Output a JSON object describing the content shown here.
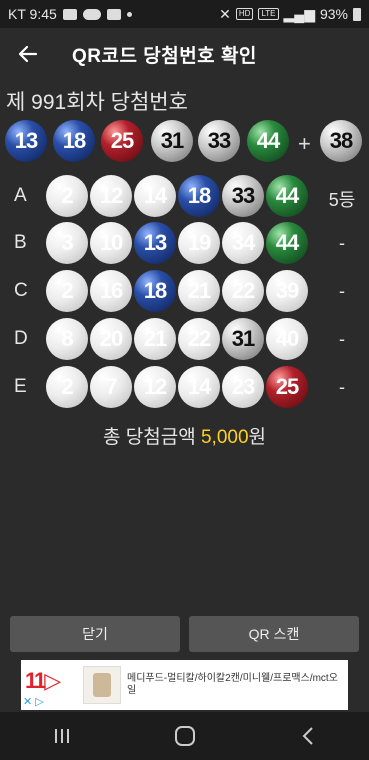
{
  "status_bar": {
    "time": "KT 9:45",
    "battery": "93%",
    "network": "LTE"
  },
  "app_bar": {
    "title": "QR코드 당첨번호 확인"
  },
  "winning": {
    "title": "제 991회차 당첨번호",
    "numbers": [
      {
        "value": "13",
        "color": "blue"
      },
      {
        "value": "18",
        "color": "blue"
      },
      {
        "value": "25",
        "color": "red"
      },
      {
        "value": "31",
        "color": "gray"
      },
      {
        "value": "33",
        "color": "gray"
      },
      {
        "value": "44",
        "color": "green"
      }
    ],
    "plus": "+",
    "bonus": {
      "value": "38",
      "color": "gray"
    }
  },
  "games": [
    {
      "label": "A",
      "result": "5등",
      "balls": [
        {
          "value": "2",
          "color": "white"
        },
        {
          "value": "12",
          "color": "white"
        },
        {
          "value": "14",
          "color": "white"
        },
        {
          "value": "18",
          "color": "blue"
        },
        {
          "value": "33",
          "color": "gray"
        },
        {
          "value": "44",
          "color": "green"
        }
      ]
    },
    {
      "label": "B",
      "result": "-",
      "balls": [
        {
          "value": "3",
          "color": "white"
        },
        {
          "value": "10",
          "color": "white"
        },
        {
          "value": "13",
          "color": "blue"
        },
        {
          "value": "19",
          "color": "white"
        },
        {
          "value": "34",
          "color": "white"
        },
        {
          "value": "44",
          "color": "green"
        }
      ]
    },
    {
      "label": "C",
      "result": "-",
      "balls": [
        {
          "value": "2",
          "color": "white"
        },
        {
          "value": "16",
          "color": "white"
        },
        {
          "value": "18",
          "color": "blue"
        },
        {
          "value": "21",
          "color": "white"
        },
        {
          "value": "22",
          "color": "white"
        },
        {
          "value": "39",
          "color": "white"
        }
      ]
    },
    {
      "label": "D",
      "result": "-",
      "balls": [
        {
          "value": "8",
          "color": "white"
        },
        {
          "value": "20",
          "color": "white"
        },
        {
          "value": "21",
          "color": "white"
        },
        {
          "value": "22",
          "color": "white"
        },
        {
          "value": "31",
          "color": "gray"
        },
        {
          "value": "40",
          "color": "white"
        }
      ]
    },
    {
      "label": "E",
      "result": "-",
      "balls": [
        {
          "value": "2",
          "color": "white"
        },
        {
          "value": "7",
          "color": "white"
        },
        {
          "value": "12",
          "color": "white"
        },
        {
          "value": "14",
          "color": "white"
        },
        {
          "value": "23",
          "color": "white"
        },
        {
          "value": "25",
          "color": "red"
        }
      ]
    }
  ],
  "total": {
    "prefix": "총 당첨금액 ",
    "amount": "5,000",
    "suffix": "원"
  },
  "buttons": {
    "close_label": "닫기",
    "scan_label": "QR 스캔"
  },
  "ad": {
    "brand": "11",
    "text": "메디푸드-멀티칼/하이칼2캔/미니웰/프로맥스/mct오일"
  }
}
